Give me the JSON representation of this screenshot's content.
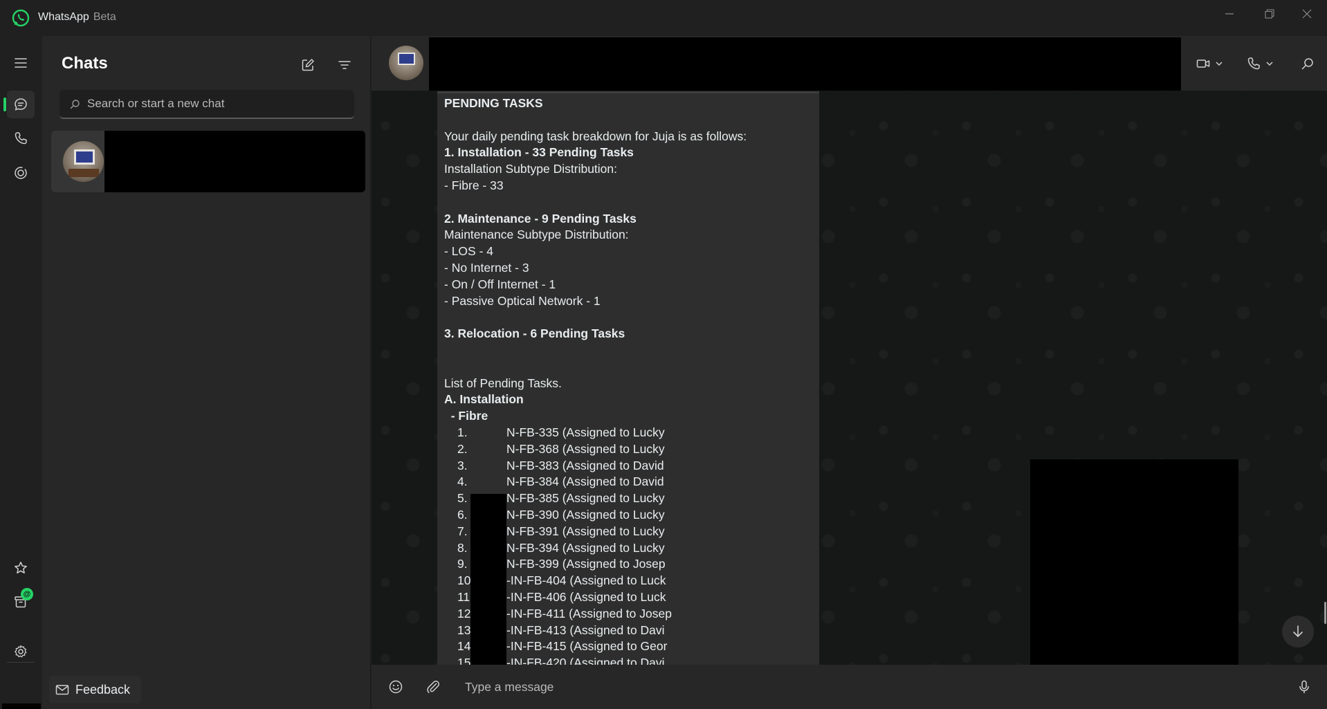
{
  "window": {
    "app_name": "WhatsApp",
    "app_tag": "Beta"
  },
  "rail": {
    "archived_badge": "@"
  },
  "chatlist": {
    "title": "Chats",
    "search_placeholder": "Search or start a new chat",
    "feedback_label": "Feedback"
  },
  "message": {
    "heading": "PENDING TASKS",
    "lines": [
      {
        "text": "",
        "bold": false
      },
      {
        "text": "Your daily pending task breakdown for Juja is as follows:",
        "bold": false
      },
      {
        "text": "1. Installation - 33 Pending Tasks",
        "bold": true
      },
      {
        "text": "Installation Subtype Distribution:",
        "bold": false
      },
      {
        "text": "- Fibre - 33",
        "bold": false
      },
      {
        "text": "",
        "bold": false
      },
      {
        "text": "2. Maintenance - 9 Pending Tasks",
        "bold": true
      },
      {
        "text": "Maintenance Subtype Distribution:",
        "bold": false
      },
      {
        "text": "- LOS - 4",
        "bold": false
      },
      {
        "text": "- No Internet - 3",
        "bold": false
      },
      {
        "text": "- On / Off Internet - 1",
        "bold": false
      },
      {
        "text": "- Passive Optical Network - 1",
        "bold": false
      },
      {
        "text": "",
        "bold": false
      },
      {
        "text": "3. Relocation - 6 Pending Tasks",
        "bold": true
      },
      {
        "text": "",
        "bold": false
      },
      {
        "text": "",
        "bold": false
      },
      {
        "text": "List of Pending Tasks.",
        "bold": false
      },
      {
        "text": "A. Installation",
        "bold": true
      },
      {
        "text": "  - Fibre",
        "bold": true
      }
    ],
    "tasks": [
      {
        "num": "1.",
        "text": "N-FB-335 (Assigned to Lucky"
      },
      {
        "num": "2.",
        "text": "N-FB-368 (Assigned to Lucky"
      },
      {
        "num": "3.",
        "text": "N-FB-383 (Assigned to David"
      },
      {
        "num": "4.",
        "text": "N-FB-384 (Assigned to David"
      },
      {
        "num": "5.",
        "text": "N-FB-385 (Assigned to Lucky"
      },
      {
        "num": "6.",
        "text": "N-FB-390 (Assigned to Lucky"
      },
      {
        "num": "7.",
        "text": "N-FB-391 (Assigned to Lucky"
      },
      {
        "num": "8.",
        "text": "N-FB-394 (Assigned to Lucky"
      },
      {
        "num": "9.",
        "text": "N-FB-399 (Assigned to Josep"
      },
      {
        "num": "10",
        "text": "-IN-FB-404 (Assigned to Luck"
      },
      {
        "num": "11",
        "text": "-IN-FB-406 (Assigned to Luck"
      },
      {
        "num": "12",
        "text": "-IN-FB-411 (Assigned to Josep"
      },
      {
        "num": "13",
        "text": "-IN-FB-413 (Assigned to Davi"
      },
      {
        "num": "14",
        "text": "-IN-FB-415 (Assigned to Geor"
      },
      {
        "num": "15",
        "text": "-IN-FB-420 (Assigned to Davi"
      }
    ]
  },
  "composer": {
    "placeholder": "Type a message"
  },
  "colors": {
    "accent": "#25d366",
    "background": "#161717",
    "panel": "#272727",
    "bubble": "#2e2e2e"
  },
  "icons": [
    "whatsapp-logo",
    "minimize-icon",
    "restore-icon",
    "close-icon",
    "menu-icon",
    "chats-icon",
    "calls-icon",
    "status-icon",
    "starred-icon",
    "archive-icon",
    "settings-icon",
    "new-chat-icon",
    "filter-icon",
    "search-icon",
    "mail-icon",
    "video-call-icon",
    "voice-call-icon",
    "chevron-down-icon",
    "emoji-icon",
    "attach-icon",
    "mic-icon",
    "arrow-down-icon"
  ]
}
